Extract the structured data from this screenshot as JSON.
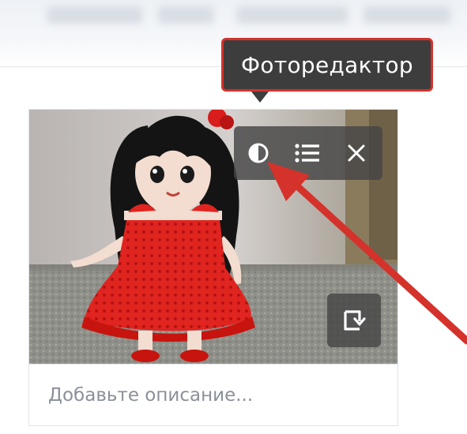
{
  "tooltip": {
    "label": "Фоторедактор"
  },
  "photo_toolbar": {
    "buttons": [
      {
        "icon": "contrast-icon"
      },
      {
        "icon": "list-icon"
      },
      {
        "icon": "close-icon"
      }
    ]
  },
  "rotate_button": {
    "icon": "rotate-icon"
  },
  "caption": {
    "placeholder": "Добавьте описание..."
  },
  "colors": {
    "annotation_red": "#d4322b",
    "tooltip_bg": "#3d3d3d",
    "caption_text": "#8a9099",
    "toolbar_bg": "#464646"
  }
}
